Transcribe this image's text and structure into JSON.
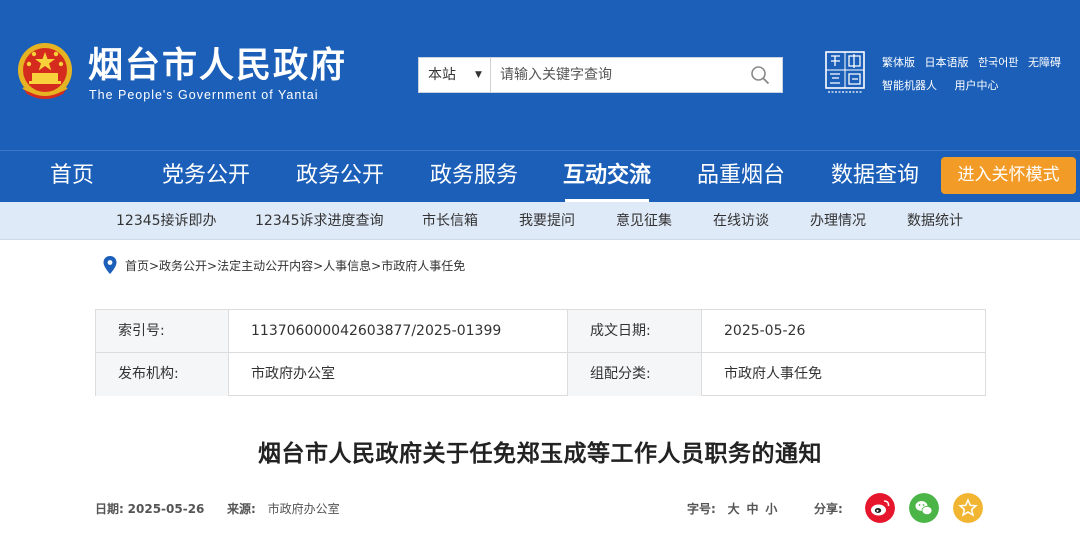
{
  "header": {
    "title": "烟台市人民政府",
    "subtitle": "The People's Government of Yantai",
    "search": {
      "scope": "本站",
      "placeholder": "请输入关键字查询"
    },
    "top_links": [
      "繁体版",
      "日本语版",
      "한국어판",
      "无障碍"
    ],
    "top_links_2": [
      "智能机器人",
      "用户中心"
    ],
    "colors": {
      "header_bg": "#1b5fb8",
      "care_button": "#f39b27"
    }
  },
  "nav": {
    "items": [
      "首页",
      "党务公开",
      "政务公开",
      "政务服务",
      "互动交流",
      "品重烟台",
      "数据查询"
    ],
    "active": "互动交流",
    "care_mode": "进入关怀模式"
  },
  "subnav": {
    "items": [
      "12345接诉即办",
      "12345诉求进度查询",
      "市长信箱",
      "我要提问",
      "意见征集",
      "在线访谈",
      "办理情况",
      "数据统计"
    ]
  },
  "breadcrumb": "首页>政务公开>法定主动公开内容>人事信息>市政府人事任免",
  "meta": {
    "index_label": "索引号:",
    "index_value": "113706000042603877/2025-01399",
    "date_label": "成文日期:",
    "date_value": "2025-05-26",
    "publisher_label": "发布机构:",
    "publisher_value": "市政府办公室",
    "category_label": "组配分类:",
    "category_value": "市政府人事任免"
  },
  "document": {
    "title": "烟台市人民政府关于任免郑玉成等工作人员职务的通知",
    "date_label": "日期:",
    "date": "2025-05-26",
    "source_label": "来源:",
    "source": "市政府办公室",
    "font_label": "字号:",
    "font_sizes": [
      "大",
      "中",
      "小"
    ],
    "share_label": "分享:",
    "share_icons": [
      "weibo-icon",
      "wechat-icon",
      "favorite-star-icon"
    ]
  }
}
